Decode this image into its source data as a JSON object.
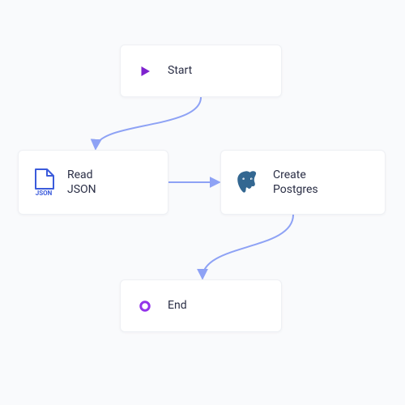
{
  "nodes": {
    "start": {
      "label": "Start"
    },
    "read_json": {
      "label": "Read\nJSON"
    },
    "create_postgres": {
      "label": "Create\nPostgres"
    },
    "end": {
      "label": "End"
    }
  },
  "edges": [
    {
      "from": "start",
      "to": "read_json"
    },
    {
      "from": "read_json",
      "to": "create_postgres"
    },
    {
      "from": "create_postgres",
      "to": "end"
    }
  ],
  "colors": {
    "connector": "#8ea2f5",
    "node_border": "#eef0f4",
    "node_bg": "#ffffff",
    "canvas_bg": "#f9fafc",
    "start_icon": "#7e22ce",
    "end_icon": "#9333ea",
    "json_icon": "#3b5bdb",
    "postgres_icon": "#336791"
  }
}
